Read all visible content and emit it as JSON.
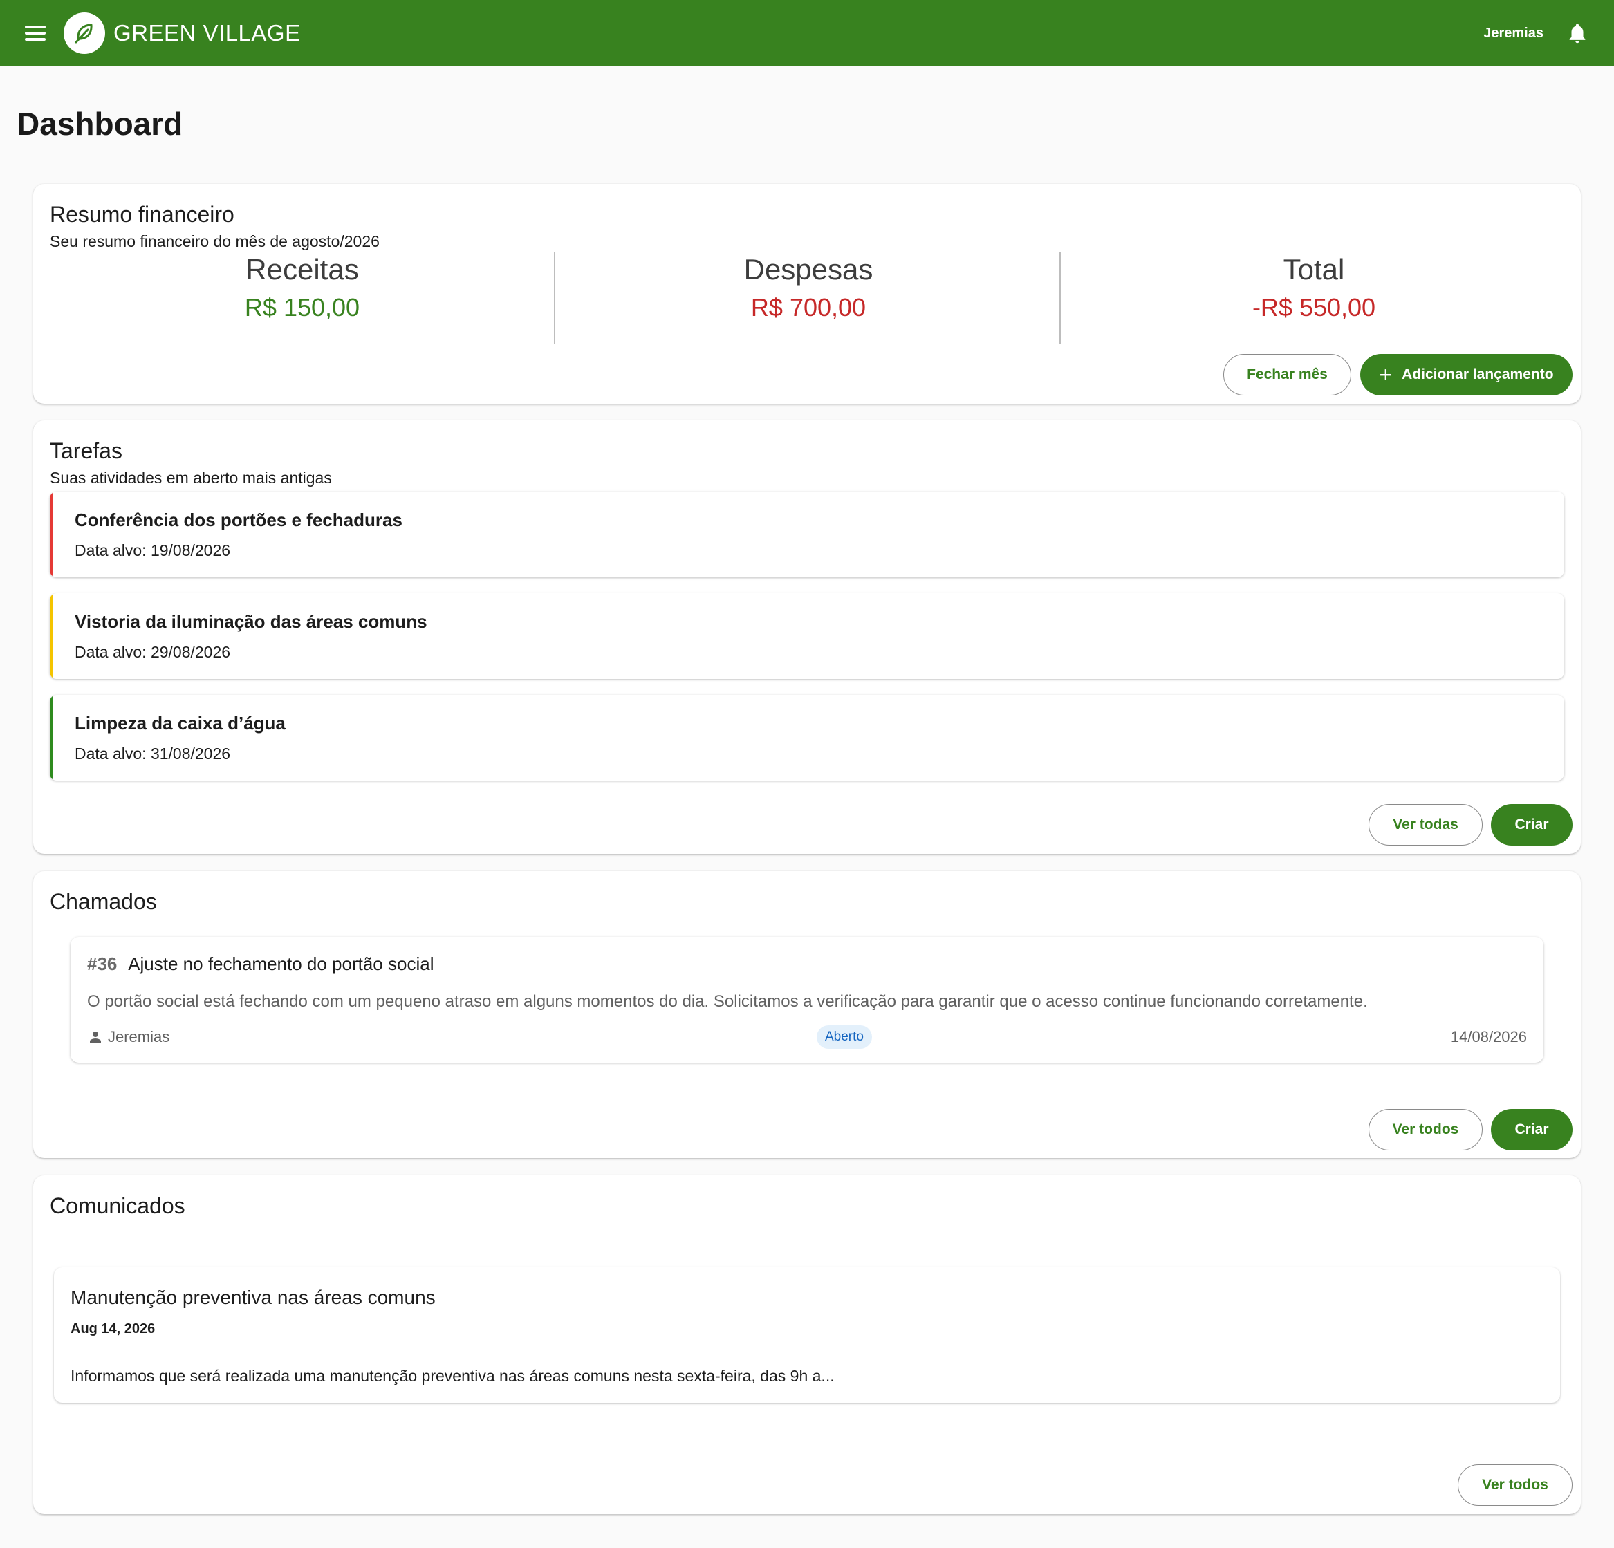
{
  "header": {
    "brand": "GREEN VILLAGE",
    "user": "Jeremias",
    "colors": {
      "primary": "#38821f"
    }
  },
  "page": {
    "title": "Dashboard"
  },
  "finance": {
    "title": "Resumo financeiro",
    "subtitle": "Seu resumo financeiro do mês de agosto/2026",
    "income_label": "Receitas",
    "income_value": "R$ 150,00",
    "expenses_label": "Despesas",
    "expenses_value": "R$ 700,00",
    "total_label": "Total",
    "total_value": "-R$ 550,00",
    "close_month_label": "Fechar mês",
    "add_entry_label": "Adicionar lançamento",
    "colors": {
      "income": "#38821f",
      "expense": "#c62828"
    }
  },
  "tasks": {
    "title": "Tarefas",
    "subtitle": "Suas atividades em aberto mais antigas",
    "items": [
      {
        "title": "Conferência dos portões e fechaduras",
        "date": "Data alvo: 19/08/2026",
        "color": "#e53935"
      },
      {
        "title": "Vistoria da iluminação das áreas comuns",
        "date": "Data alvo: 29/08/2026",
        "color": "#f4c400"
      },
      {
        "title": "Limpeza da caixa d’água",
        "date": "Data alvo: 31/08/2026",
        "color": "#2e8b1e"
      }
    ],
    "view_all_label": "Ver todas",
    "create_label": "Criar"
  },
  "tickets": {
    "title": "Chamados",
    "items": [
      {
        "id": "#36",
        "title": "Ajuste no fechamento do portão social",
        "description": "O portão social está fechando com um pequeno atraso em alguns momentos do dia. Solicitamos a verificação para garantir que o acesso continue funcionando corretamente.",
        "author": "Jeremias",
        "status": "Aberto",
        "date": "14/08/2026"
      }
    ],
    "view_all_label": "Ver todos",
    "create_label": "Criar"
  },
  "announcements": {
    "title": "Comunicados",
    "items": [
      {
        "title": "Manutenção preventiva nas áreas comuns",
        "date": "Aug 14, 2026",
        "body": "Informamos que será realizada uma manutenção preventiva nas áreas comuns nesta sexta-feira, das 9h a..."
      }
    ],
    "view_all_label": "Ver todos"
  }
}
